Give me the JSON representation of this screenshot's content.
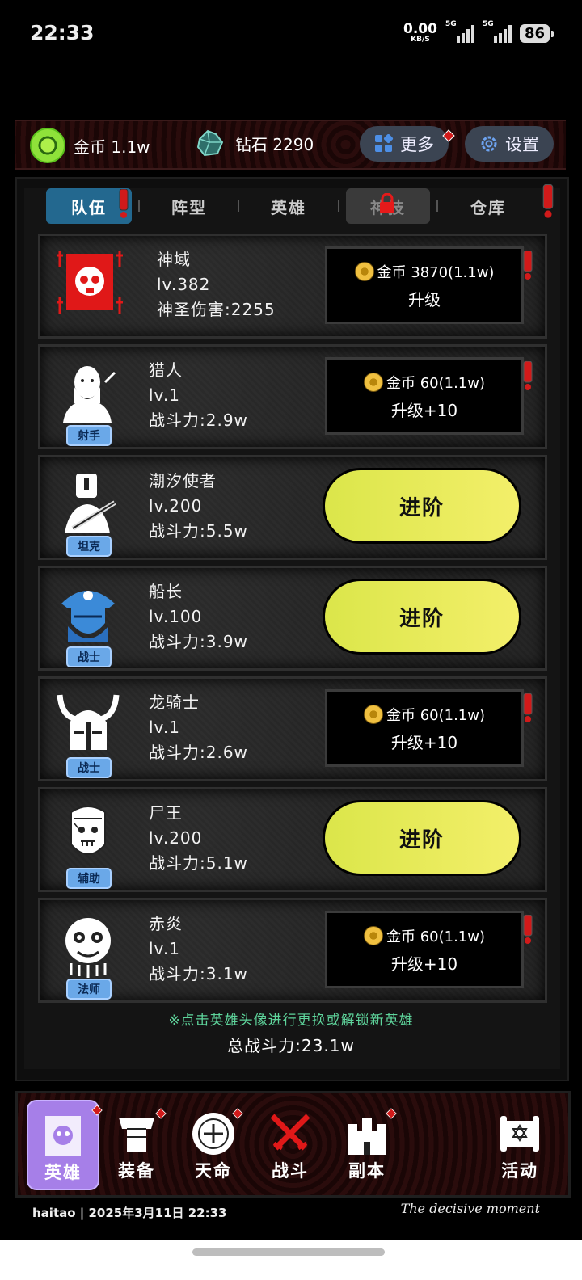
{
  "status": {
    "time": "22:33",
    "netspeed": "0.00",
    "netspeed_unit": "KB/S",
    "sim1": "5G",
    "sim2": "5G",
    "battery": "86"
  },
  "resources": {
    "gold_label": "金币 1.1w",
    "diamond_label": "钻石 2290",
    "more_label": "更多",
    "settings_label": "设置"
  },
  "tabs": [
    {
      "label": "队伍",
      "active": true
    },
    {
      "label": "阵型"
    },
    {
      "label": "英雄"
    },
    {
      "label": "神技",
      "locked": true
    },
    {
      "label": "仓库"
    }
  ],
  "cards": [
    {
      "name": "神域",
      "level": "lv.382",
      "stat": "神圣伤害:2255",
      "role": "",
      "action": "upgrade",
      "cost": "金币 3870(1.1w)",
      "action_label": "升级",
      "avatar_icon": "skull-totem-icon"
    },
    {
      "name": "猎人",
      "level": "lv.1",
      "stat": "战斗力:2.9w",
      "role": "射手",
      "action": "upgrade",
      "cost": "金币 60(1.1w)",
      "action_label": "升级+10",
      "avatar_icon": "hunter-icon"
    },
    {
      "name": "潮汐使者",
      "level": "lv.200",
      "stat": "战斗力:5.5w",
      "role": "坦克",
      "action": "advance",
      "action_label": "进阶",
      "avatar_icon": "tide-knight-icon"
    },
    {
      "name": "船长",
      "level": "lv.100",
      "stat": "战斗力:3.9w",
      "role": "战士",
      "action": "advance",
      "action_label": "进阶",
      "avatar_icon": "pirate-captain-icon"
    },
    {
      "name": "龙骑士",
      "level": "lv.1",
      "stat": "战斗力:2.6w",
      "role": "战士",
      "action": "upgrade",
      "cost": "金币 60(1.1w)",
      "action_label": "升级+10",
      "avatar_icon": "viking-helmet-icon"
    },
    {
      "name": "尸王",
      "level": "lv.200",
      "stat": "战斗力:5.1w",
      "role": "辅助",
      "action": "advance",
      "action_label": "进阶",
      "avatar_icon": "zombie-king-icon"
    },
    {
      "name": "赤炎",
      "level": "lv.1",
      "stat": "战斗力:3.1w",
      "role": "法师",
      "action": "upgrade",
      "cost": "金币 60(1.1w)",
      "action_label": "升级+10",
      "avatar_icon": "lion-mask-icon"
    }
  ],
  "hint": "※点击英雄头像进行更换或解锁新英雄",
  "total_power": "总战斗力:23.1w",
  "nav": [
    {
      "label": "英雄",
      "active": true,
      "icon": "hero-icon"
    },
    {
      "label": "装备",
      "icon": "armor-icon"
    },
    {
      "label": "天命",
      "icon": "destiny-icon"
    },
    {
      "label": "战斗",
      "icon": "crossed-swords-icon"
    },
    {
      "label": "副本",
      "icon": "castle-icon"
    },
    {
      "label": "活动",
      "icon": "scroll-icon"
    }
  ],
  "footer": {
    "text": "haitao | 2025年3月11日 22:33",
    "signature": "The decisive moment"
  },
  "colors": {
    "accent_tab": "#23688f",
    "advance_btn": "#e6ea55",
    "alert": "#d11a1a",
    "role_badge": "#6aa8e8",
    "hint": "#5ed49b"
  }
}
